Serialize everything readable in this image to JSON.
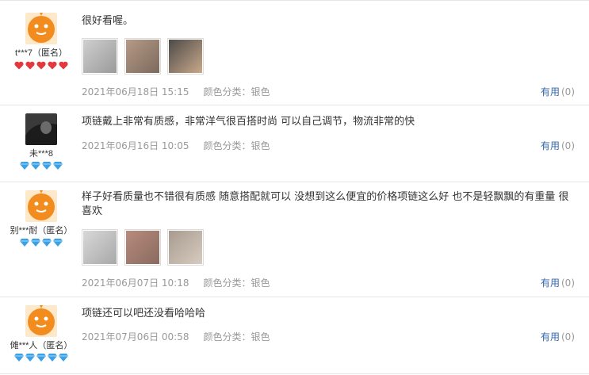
{
  "reviews": [
    {
      "username": "t***7（匿名）",
      "level_icon": "heart-icon",
      "level_count": 5,
      "text": "很好看喔。",
      "images": [
        "review-photo-1",
        "review-photo-2",
        "review-photo-3"
      ],
      "date": "2021年06月18日 15:15",
      "spec": "颜色分类：银色",
      "useful_label": "有用",
      "useful_count": "(0)"
    },
    {
      "username": "未***8",
      "level_icon": "diamond-icon",
      "level_count": 4,
      "text": "项链戴上非常有质感，非常洋气很百搭时尚 可以自己调节，物流非常的快",
      "images": [],
      "date": "2021年06月16日 10:05",
      "spec": "颜色分类：银色",
      "useful_label": "有用",
      "useful_count": "(0)"
    },
    {
      "username": "别***耐（匿名）",
      "level_icon": "diamond-icon",
      "level_count": 4,
      "text": "样子好看质量也不错很有质感 随意搭配就可以 没想到这么便宜的价格项链这么好 也不是轻飘飘的有重量 很喜欢",
      "images": [
        "review-photo-1",
        "review-photo-2",
        "review-photo-3"
      ],
      "date": "2021年06月07日 10:18",
      "spec": "颜色分类：银色",
      "useful_label": "有用",
      "useful_count": "(0)"
    },
    {
      "username": "傩***人（匿名）",
      "level_icon": "diamond-icon",
      "level_count": 5,
      "text": "项链还可以吧还没看哈哈哈",
      "images": [],
      "date": "2021年07月06日 00:58",
      "spec": "颜色分类：银色",
      "useful_label": "有用",
      "useful_count": "(0)"
    }
  ],
  "colors": {
    "link": "#3366aa",
    "meta": "#999999",
    "heart": "#e4393c",
    "diamond": "#3ba0e6",
    "avatar": "#f28c1e"
  }
}
